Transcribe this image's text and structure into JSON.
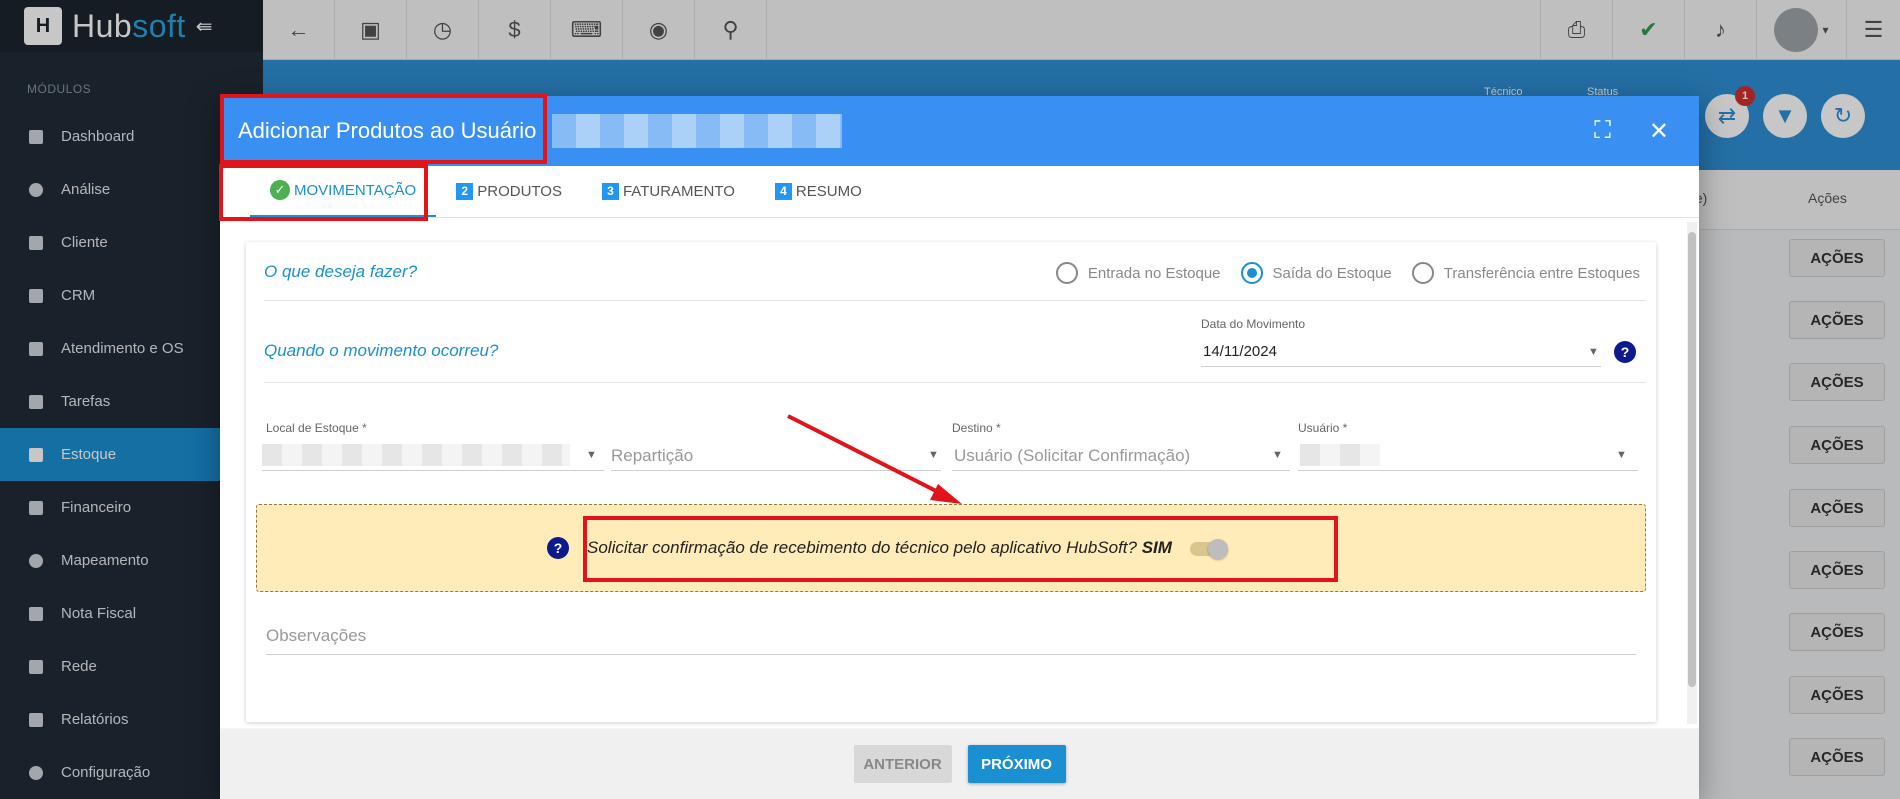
{
  "brand": {
    "name_part1": "Hub",
    "name_part2": "soft"
  },
  "sidebar": {
    "section_title": "MÓDULOS",
    "items": [
      {
        "label": "Dashboard"
      },
      {
        "label": "Análise"
      },
      {
        "label": "Cliente"
      },
      {
        "label": "CRM"
      },
      {
        "label": "Atendimento e OS"
      },
      {
        "label": "Tarefas"
      },
      {
        "label": "Estoque"
      },
      {
        "label": "Financeiro"
      },
      {
        "label": "Mapeamento"
      },
      {
        "label": "Nota Fiscal"
      },
      {
        "label": "Rede"
      },
      {
        "label": "Relatórios"
      },
      {
        "label": "Configuração"
      }
    ]
  },
  "background": {
    "header_small_1": "Técnico",
    "header_small_2": "Status",
    "notification_count": "1",
    "col_partial": "fe)",
    "col_acoes": "Ações",
    "row_button": "AÇÕES"
  },
  "modal": {
    "title": "Adicionar Produtos ao Usuário",
    "tabs": [
      {
        "num": "",
        "label": "MOVIMENTAÇÃO"
      },
      {
        "num": "2",
        "label": "PRODUTOS"
      },
      {
        "num": "3",
        "label": "FATURAMENTO"
      },
      {
        "num": "4",
        "label": "RESUMO"
      }
    ],
    "question_1": "O que deseja fazer?",
    "radios": [
      {
        "label": "Entrada no Estoque",
        "selected": false
      },
      {
        "label": "Saída do Estoque",
        "selected": true
      },
      {
        "label": "Transferência entre Estoques",
        "selected": false
      }
    ],
    "question_2": "Quando o movimento ocorreu?",
    "date_label": "Data do Movimento",
    "date_value": "14/11/2024",
    "help_glyph": "?",
    "local_label": "Local de Estoque *",
    "reparticao_placeholder": "Repartição",
    "destino_label": "Destino *",
    "destino_value": "Usuário (Solicitar Confirmação)",
    "usuario_label": "Usuário *",
    "notice_text": "Solicitar confirmação de recebimento do técnico pelo aplicativo HubSoft?",
    "notice_value": "SIM",
    "observacoes_placeholder": "Observações",
    "btn_prev": "ANTERIOR",
    "btn_next": "PRÓXIMO"
  },
  "colors": {
    "sidebar_bg": "#212b36",
    "accent": "#1a8fd1",
    "modal_header": "#3a8ff2",
    "notice_bg": "#ffecb8",
    "annotation_red": "#e0141a"
  }
}
